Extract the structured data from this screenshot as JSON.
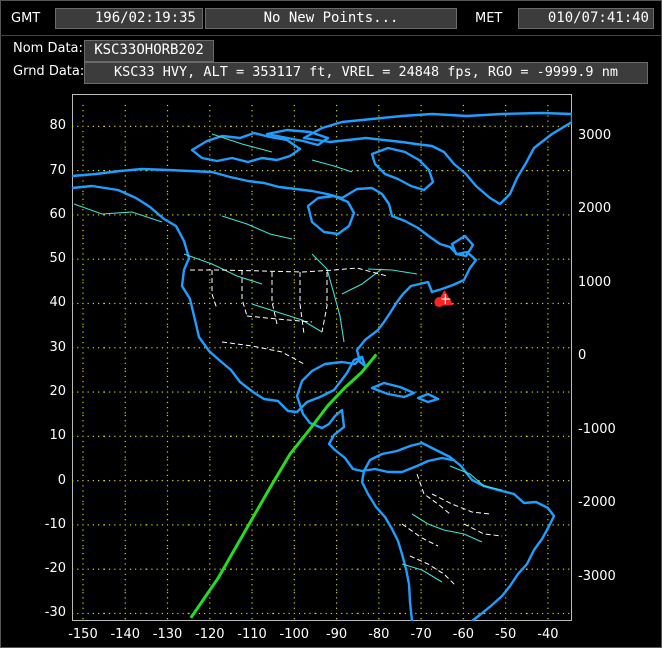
{
  "header": {
    "gmt_label": "GMT",
    "gmt_value": "196/02:19:35",
    "status": "No New Points...",
    "met_label": "MET",
    "met_value": "010/07:41:40"
  },
  "info": {
    "nom_label": "Nom Data:",
    "nom_value": "KSC33OHORB202",
    "grnd_label": "Grnd Data:",
    "grnd_value": "KSC33 HVY, ALT = 353117 ft, VREL = 24848 fps, RGO = -9999.9 nm"
  },
  "map": {
    "lat_ticks": [
      "80",
      "70",
      "60",
      "50",
      "40",
      "30",
      "20",
      "10",
      "0",
      "-10",
      "-20",
      "-30"
    ],
    "lon_ticks": [
      "-150",
      "-140",
      "-130",
      "-120",
      "-110",
      "-100",
      "-90",
      "-80",
      "-70",
      "-60",
      "-50",
      "-40"
    ],
    "alt_ticks": [
      "3000",
      "2000",
      "1000",
      "0",
      "-1000",
      "-2000",
      "-3000"
    ],
    "colors": {
      "coast": "#1e9fff",
      "rivers": "#40e0d0",
      "borders": "#ffffff",
      "trajectory": "#22dd22",
      "marker": "#ff2020",
      "grid": "#d8d800"
    },
    "trajectory": [
      [
        -124.5,
        -31
      ],
      [
        -118,
        -22
      ],
      [
        -112,
        -12
      ],
      [
        -106,
        -2
      ],
      [
        -101,
        6
      ],
      [
        -96,
        12
      ],
      [
        -92,
        17
      ],
      [
        -88,
        21
      ],
      [
        -84,
        24.5
      ],
      [
        -80.6,
        28.5
      ]
    ],
    "landing_marker": [
      -64.5,
      41
    ]
  }
}
